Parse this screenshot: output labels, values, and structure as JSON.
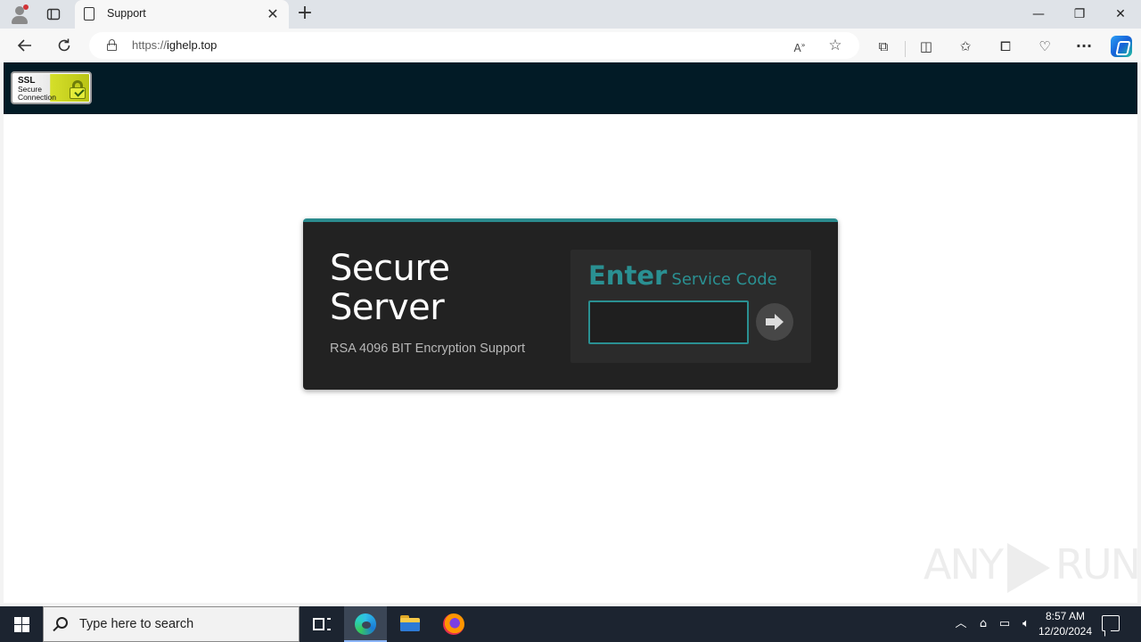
{
  "browser": {
    "tab_title": "Support",
    "url_scheme": "https://",
    "url_host": "ighelp.top"
  },
  "site": {
    "ssl_badge": {
      "line1": "SSL",
      "line2": "Secure",
      "line3": "Connection"
    },
    "card": {
      "title_line1": "Secure",
      "title_line2": "Server",
      "subtitle": "RSA 4096 BIT Encryption Support",
      "code_label_big": "Enter",
      "code_label_small": "Service Code",
      "code_value": ""
    },
    "watermark": {
      "left": "ANY",
      "right": "RUN"
    }
  },
  "taskbar": {
    "search_placeholder": "Type here to search",
    "time": "8:57 AM",
    "date": "12/20/2024"
  },
  "colors": {
    "accent_teal": "#2a9092",
    "header_bg": "#021b26",
    "card_bg": "#222222"
  }
}
